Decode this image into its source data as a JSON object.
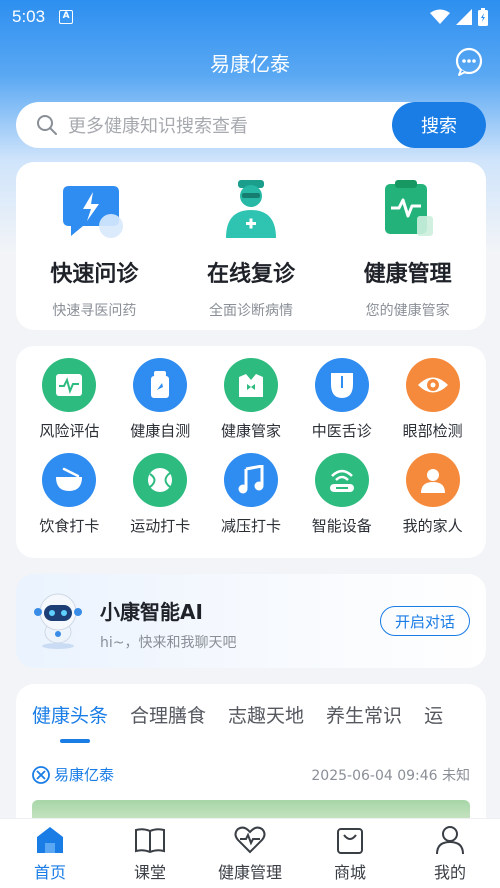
{
  "status_bar": {
    "time": "5:03",
    "notification": "A"
  },
  "header": {
    "title": "易康亿泰"
  },
  "search": {
    "placeholder": "更多健康知识搜索查看",
    "button": "搜索"
  },
  "services": [
    {
      "title": "快速问诊",
      "subtitle": "快速寻医问药",
      "icon": "lightning-chat-icon"
    },
    {
      "title": "在线复诊",
      "subtitle": "全面诊断病情",
      "icon": "doctor-icon"
    },
    {
      "title": "健康管理",
      "subtitle": "您的健康管家",
      "icon": "clipboard-pulse-icon"
    }
  ],
  "features": [
    {
      "label": "风险评估",
      "icon": "heart-rate-chart-icon",
      "color": "#2dbb7f"
    },
    {
      "label": "健康自测",
      "icon": "test-jar-icon",
      "color": "#2f8cf0"
    },
    {
      "label": "健康管家",
      "icon": "butler-icon",
      "color": "#2dbb7f"
    },
    {
      "label": "中医舌诊",
      "icon": "tongue-icon",
      "color": "#2f8cf0"
    },
    {
      "label": "眼部检测",
      "icon": "eye-icon",
      "color": "#f58a3c"
    },
    {
      "label": "饮食打卡",
      "icon": "bowl-icon",
      "color": "#2f8cf0"
    },
    {
      "label": "运动打卡",
      "icon": "ball-icon",
      "color": "#2dbb7f"
    },
    {
      "label": "减压打卡",
      "icon": "music-note-icon",
      "color": "#2f8cf0"
    },
    {
      "label": "智能设备",
      "icon": "smart-device-icon",
      "color": "#2dbb7f"
    },
    {
      "label": "我的家人",
      "icon": "family-person-icon",
      "color": "#f58a3c"
    }
  ],
  "ai": {
    "title": "小康智能AI",
    "subtitle": "hi~，快来和我聊天吧",
    "button": "开启对话"
  },
  "news": {
    "tabs": [
      "健康头条",
      "合理膳食",
      "志趣天地",
      "养生常识",
      "运"
    ],
    "active_tab": 0,
    "source": "易康亿泰",
    "time": "2025-06-04 09:46 未知"
  },
  "tabbar": [
    {
      "label": "首页",
      "icon": "home-icon",
      "active": true
    },
    {
      "label": "课堂",
      "icon": "book-icon",
      "active": false
    },
    {
      "label": "健康管理",
      "icon": "heart-pulse-icon",
      "active": false
    },
    {
      "label": "商城",
      "icon": "shopping-bag-icon",
      "active": false
    },
    {
      "label": "我的",
      "icon": "profile-icon",
      "active": false
    }
  ],
  "colors": {
    "primary": "#1a7de6",
    "green": "#2dbb7f",
    "orange": "#f58a3c"
  }
}
